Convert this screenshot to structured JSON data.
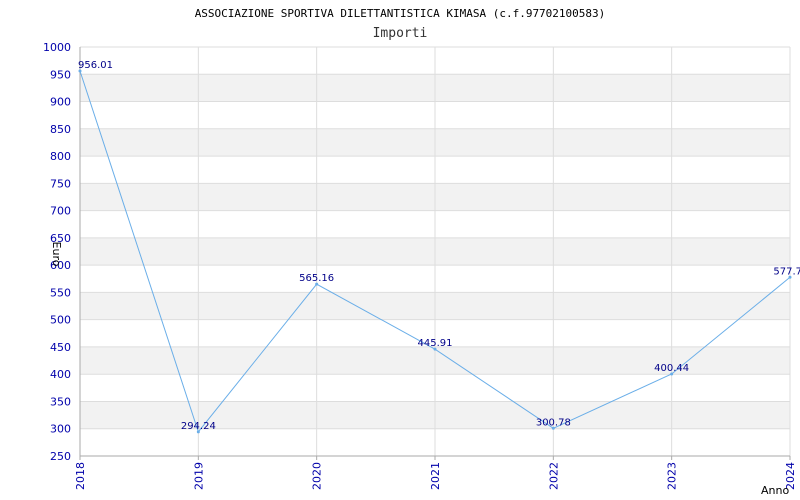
{
  "chart_data": {
    "type": "line",
    "title": "ASSOCIAZIONE SPORTIVA DILETTANTISTICA KIMASA (c.f.97702100583)",
    "subtitle": "Importi",
    "xlabel": "Anno",
    "ylabel": "Euro",
    "categories": [
      "2018",
      "2019",
      "2020",
      "2021",
      "2022",
      "2023",
      "2024"
    ],
    "series": [
      {
        "values": [
          956.01,
          294.24,
          565.16,
          445.91,
          300.78,
          400.44,
          577.7
        ],
        "labels": [
          "956.01",
          "294.24",
          "565.16",
          "445.91",
          "300.78",
          "400.44",
          "577.7"
        ]
      }
    ],
    "ylim": [
      250,
      1000
    ],
    "yticks": [
      250,
      300,
      350,
      400,
      450,
      500,
      550,
      600,
      650,
      700,
      750,
      800,
      850,
      900,
      950,
      1000
    ],
    "grid": true,
    "colors": {
      "line": "#6aaee8",
      "band": "#f2f2f2",
      "grid": "#dddddd",
      "axis": "#aaaaaa"
    }
  }
}
